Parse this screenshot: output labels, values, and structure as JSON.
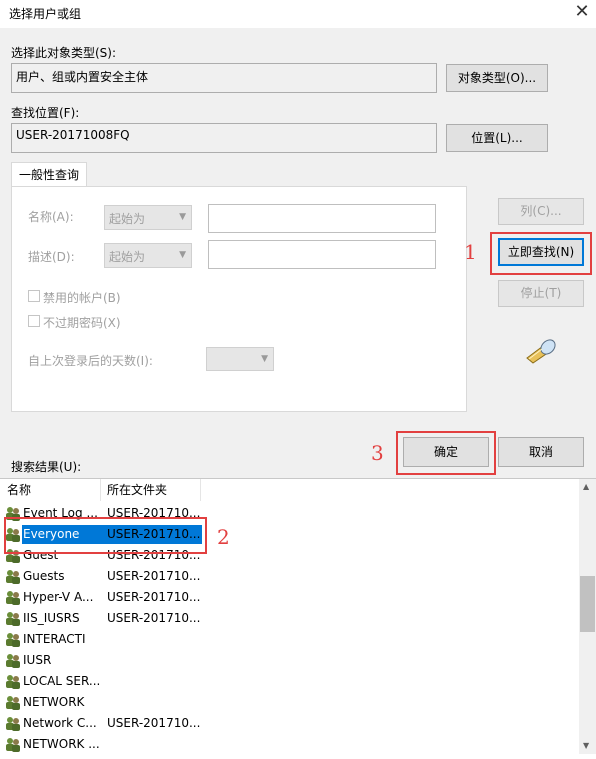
{
  "window": {
    "title": "选择用户或组"
  },
  "object_type": {
    "label": "选择此对象类型(S):",
    "value": "用户、组或内置安全主体",
    "button": "对象类型(O)..."
  },
  "location": {
    "label": "查找位置(F):",
    "value": "USER-20171008FQ",
    "button": "位置(L)..."
  },
  "query": {
    "tab": "一般性查询",
    "name_label": "名称(A):",
    "name_combo": "起始为",
    "desc_label": "描述(D):",
    "desc_combo": "起始为",
    "disabled_accounts": "禁用的帐户(B)",
    "no_expire_pwd": "不过期密码(X)",
    "days_label": "自上次登录后的天数(I):"
  },
  "buttons": {
    "columns": "列(C)...",
    "find_now": "立即查找(N)",
    "stop": "停止(T)",
    "ok": "确定",
    "cancel": "取消"
  },
  "results": {
    "label": "搜索结果(U):",
    "headers": [
      "名称",
      "所在文件夹"
    ],
    "rows": [
      {
        "name": "Event Log ...",
        "folder": "USER-201710..."
      },
      {
        "name": "Everyone",
        "folder": "USER-201710...",
        "selected": true
      },
      {
        "name": "Guest",
        "folder": "USER-201710..."
      },
      {
        "name": "Guests",
        "folder": "USER-201710..."
      },
      {
        "name": "Hyper-V A...",
        "folder": "USER-201710..."
      },
      {
        "name": "IIS_IUSRS",
        "folder": "USER-201710..."
      },
      {
        "name": "INTERACTI",
        "folder": ""
      },
      {
        "name": "IUSR",
        "folder": ""
      },
      {
        "name": "LOCAL SER...",
        "folder": ""
      },
      {
        "name": "NETWORK",
        "folder": ""
      },
      {
        "name": "Network C...",
        "folder": "USER-201710..."
      },
      {
        "name": "NETWORK ...",
        "folder": ""
      }
    ]
  },
  "annotations": {
    "n1": "1",
    "n2": "2",
    "n3": "3"
  },
  "colors": {
    "selection": "#0078d7",
    "annotation": "#e24040"
  }
}
